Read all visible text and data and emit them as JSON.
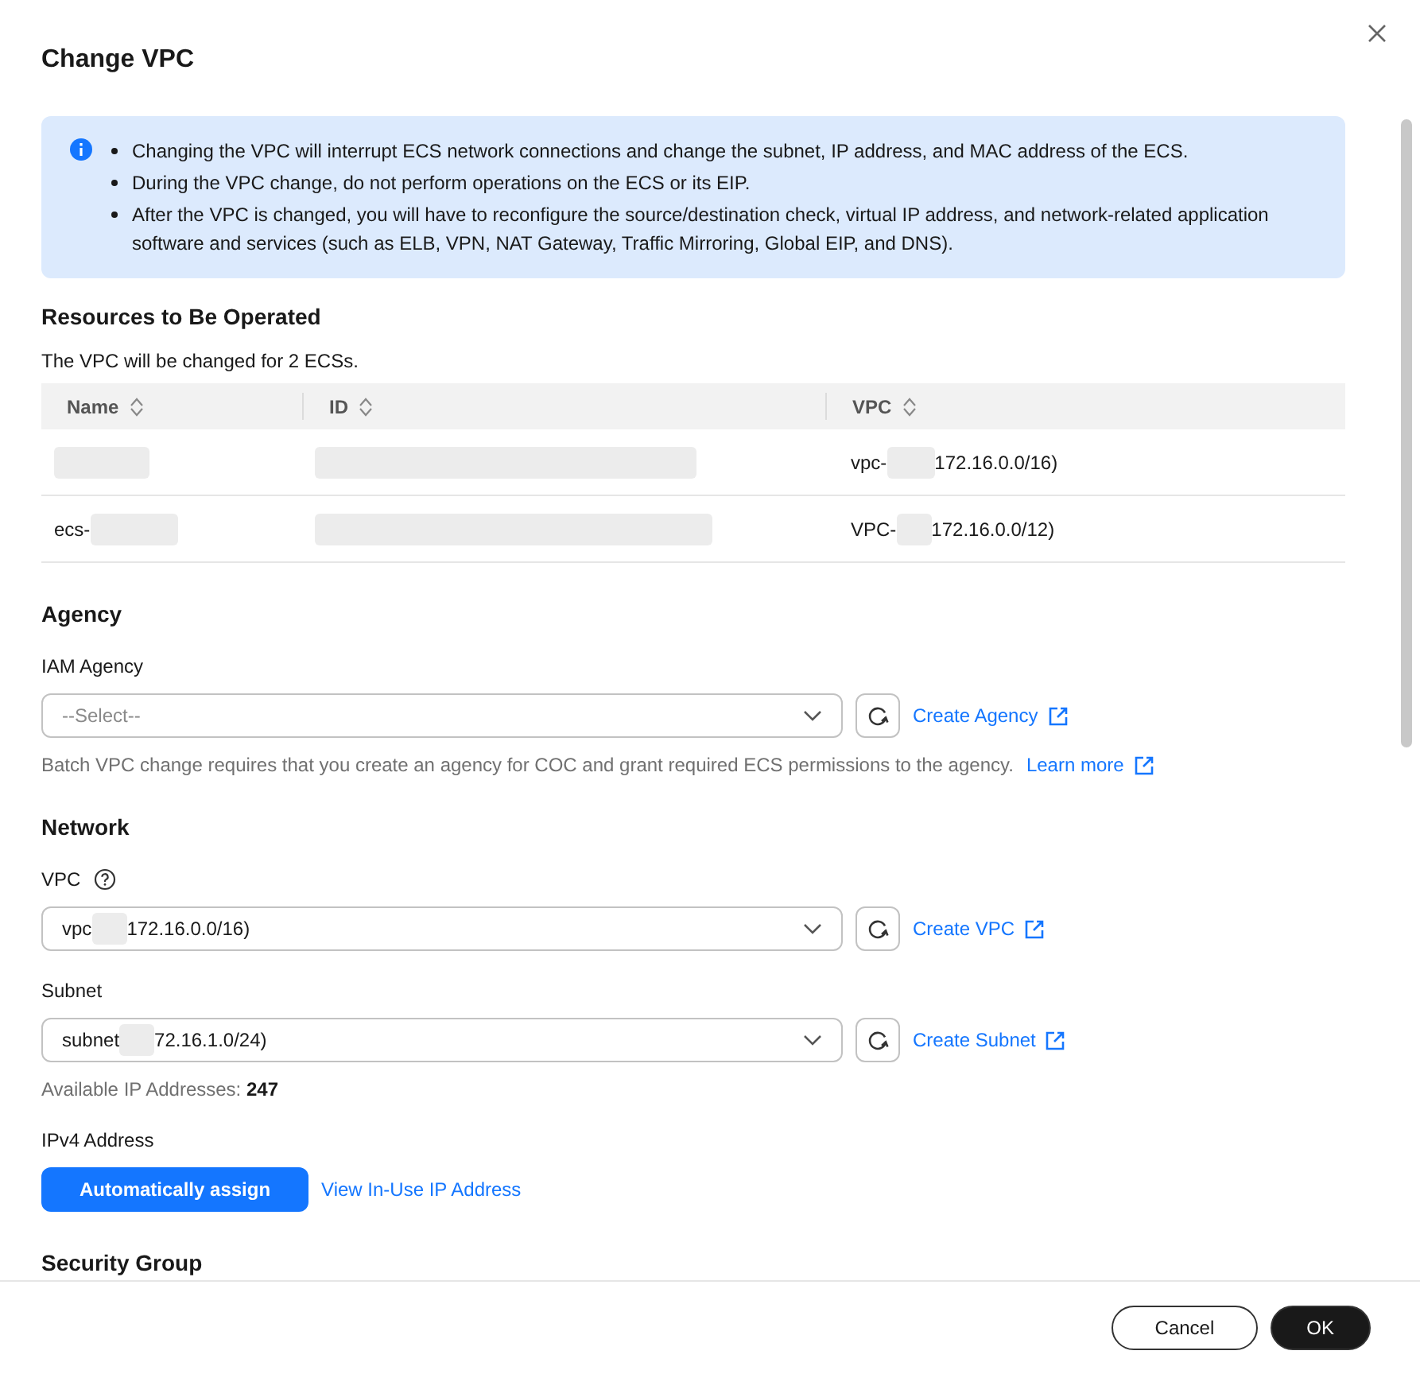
{
  "dialog": {
    "title": "Change VPC"
  },
  "notice": {
    "items": [
      "Changing the VPC will interrupt ECS network connections and change the subnet, IP address, and MAC address of the ECS.",
      "During the VPC change, do not perform operations on the ECS or its EIP.",
      "After the VPC is changed, you will have to reconfigure the source/destination check, virtual IP address, and network-related application software and services (such as ELB, VPN, NAT Gateway, Traffic Mirroring, Global EIP, and DNS)."
    ]
  },
  "resources": {
    "heading": "Resources to Be Operated",
    "summary": "The VPC will be changed for 2 ECSs.",
    "columns": [
      {
        "label": "Name",
        "sortable": true
      },
      {
        "label": "ID",
        "sortable": true
      },
      {
        "label": "VPC",
        "sortable": true
      }
    ],
    "rows": [
      {
        "cells": [
          {
            "redacted": true
          },
          {
            "redacted": true
          },
          {
            "before": "vpc-",
            "redacted": true,
            "after": "172.16.0.0/16)"
          }
        ]
      },
      {
        "cells": [
          {
            "before": "ecs-",
            "redacted": true
          },
          {
            "redacted": true
          },
          {
            "before": "VPC-",
            "redacted": true,
            "after": "172.16.0.0/12)"
          }
        ]
      }
    ]
  },
  "sections": [
    {
      "heading": "Agency",
      "fields": [
        {
          "kind": "select",
          "label": "IAM Agency",
          "placeholder": "--Select--",
          "link": "Create Agency",
          "hint": "Batch VPC change requires that you create an agency for COC and grant required ECS permissions to the agency.",
          "hint_link": "Learn more"
        }
      ]
    },
    {
      "heading": "Network",
      "fields": [
        {
          "kind": "select",
          "label": "VPC",
          "help": true,
          "value_before": "vpc",
          "redacted": true,
          "value_after": "172.16.0.0/16)",
          "link": "Create VPC"
        },
        {
          "kind": "select",
          "label": "Subnet",
          "value_before": "subnet",
          "redacted": true,
          "value_after": "72.16.1.0/24)",
          "link": "Create Subnet",
          "info": "Available IP Addresses: **247**"
        },
        {
          "kind": "buttons",
          "label": "IPv4 Address",
          "button": "Automatically assign",
          "link": "View In-Use IP Address"
        }
      ]
    },
    {
      "heading": "Security Group"
    }
  ],
  "footer": {
    "buttons": [
      {
        "label": "Cancel",
        "primary": false
      },
      {
        "label": "OK",
        "primary": true
      }
    ]
  }
}
